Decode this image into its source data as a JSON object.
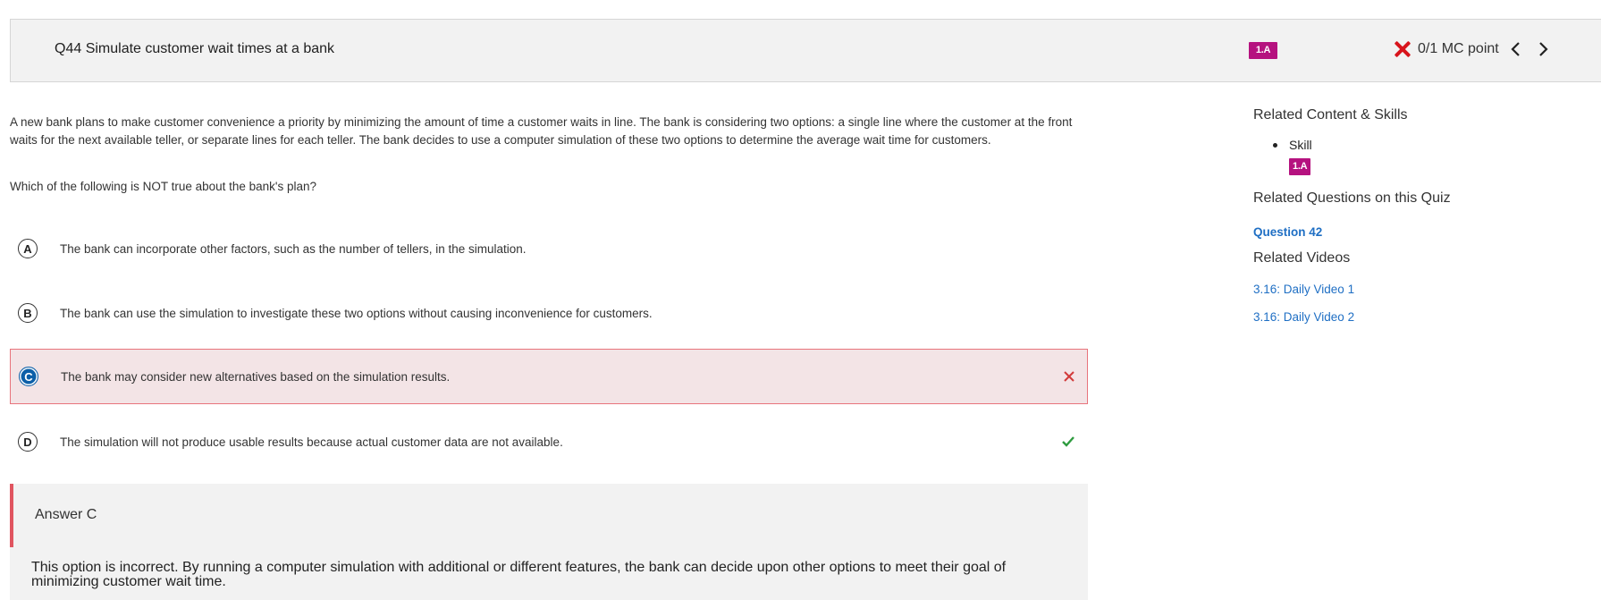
{
  "header": {
    "title": "Q44 Simulate customer wait times at a bank",
    "skill_badge": "1.A",
    "score": "0/1 MC point",
    "prev_icon": "chevron-left-icon",
    "next_icon": "chevron-right-icon",
    "incorrect_icon": "x-icon"
  },
  "question": {
    "stem": "A new bank plans to make customer convenience a priority by minimizing the amount of time a customer waits in line. The bank is considering two options: a single line where the customer at the front waits for the next available teller, or separate lines for each teller. The bank decides to use a computer simulation of these two options to determine the average wait time for customers.",
    "prompt": "Which of the following is NOT true about the bank's plan?",
    "choices": [
      {
        "letter": "A",
        "text": "The bank can incorporate other factors, such as the number of tellers, in the simulation."
      },
      {
        "letter": "B",
        "text": "The bank can use the simulation to investigate these two options without causing inconvenience for customers."
      },
      {
        "letter": "C",
        "text": "The bank may consider new alternatives based on the simulation results."
      },
      {
        "letter": "D",
        "text": "The simulation will not produce usable results because actual customer data are not available."
      }
    ],
    "selected": "C",
    "correct": "D"
  },
  "explanation": {
    "answer_label": "Answer C",
    "body": "This option is incorrect. By running a computer simulation with additional or different features, the bank can decide upon other options to meet their goal of minimizing customer wait time."
  },
  "sidebar": {
    "related_heading": "Related Content & Skills",
    "skill_label": "Skill",
    "skill_badge": "1.A",
    "related_questions_heading": "Related Questions on this Quiz",
    "related_question": "Question 42",
    "related_videos_heading": "Related Videos",
    "videos": [
      "3.16: Daily Video 1",
      "3.16: Daily Video 2"
    ]
  },
  "colors": {
    "skill_badge": "#b5127f",
    "incorrect_red": "#d8141c",
    "correct_green": "#2e9b3f",
    "selected_blue": "#0c5fa8",
    "link_blue": "#1f6fc4",
    "wrong_bg": "#f3e4e6"
  }
}
